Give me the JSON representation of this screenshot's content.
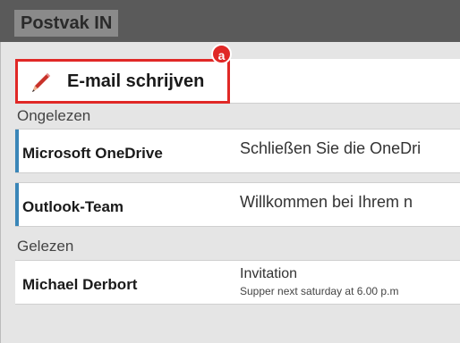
{
  "header": {
    "title": "Postvak IN"
  },
  "compose": {
    "label": "E-mail schrijven",
    "icon": "pencil-icon",
    "marker": "a",
    "highlight_color": "#e02826"
  },
  "sections": {
    "unread": {
      "label": "Ongelezen"
    },
    "read": {
      "label": "Gelezen"
    }
  },
  "messages": [
    {
      "sender": "Microsoft OneDrive",
      "subject": "Schließen Sie die OneDri",
      "status": "unread"
    },
    {
      "sender": "Outlook-Team",
      "subject": "Willkommen bei Ihrem n",
      "status": "unread"
    },
    {
      "sender": "Michael Derbort",
      "subject": "Invitation",
      "preview": "Supper next saturday at 6.00 p.m",
      "status": "read"
    }
  ],
  "colors": {
    "accent": "#3a86b8",
    "header_bg": "#5a5a5a"
  }
}
